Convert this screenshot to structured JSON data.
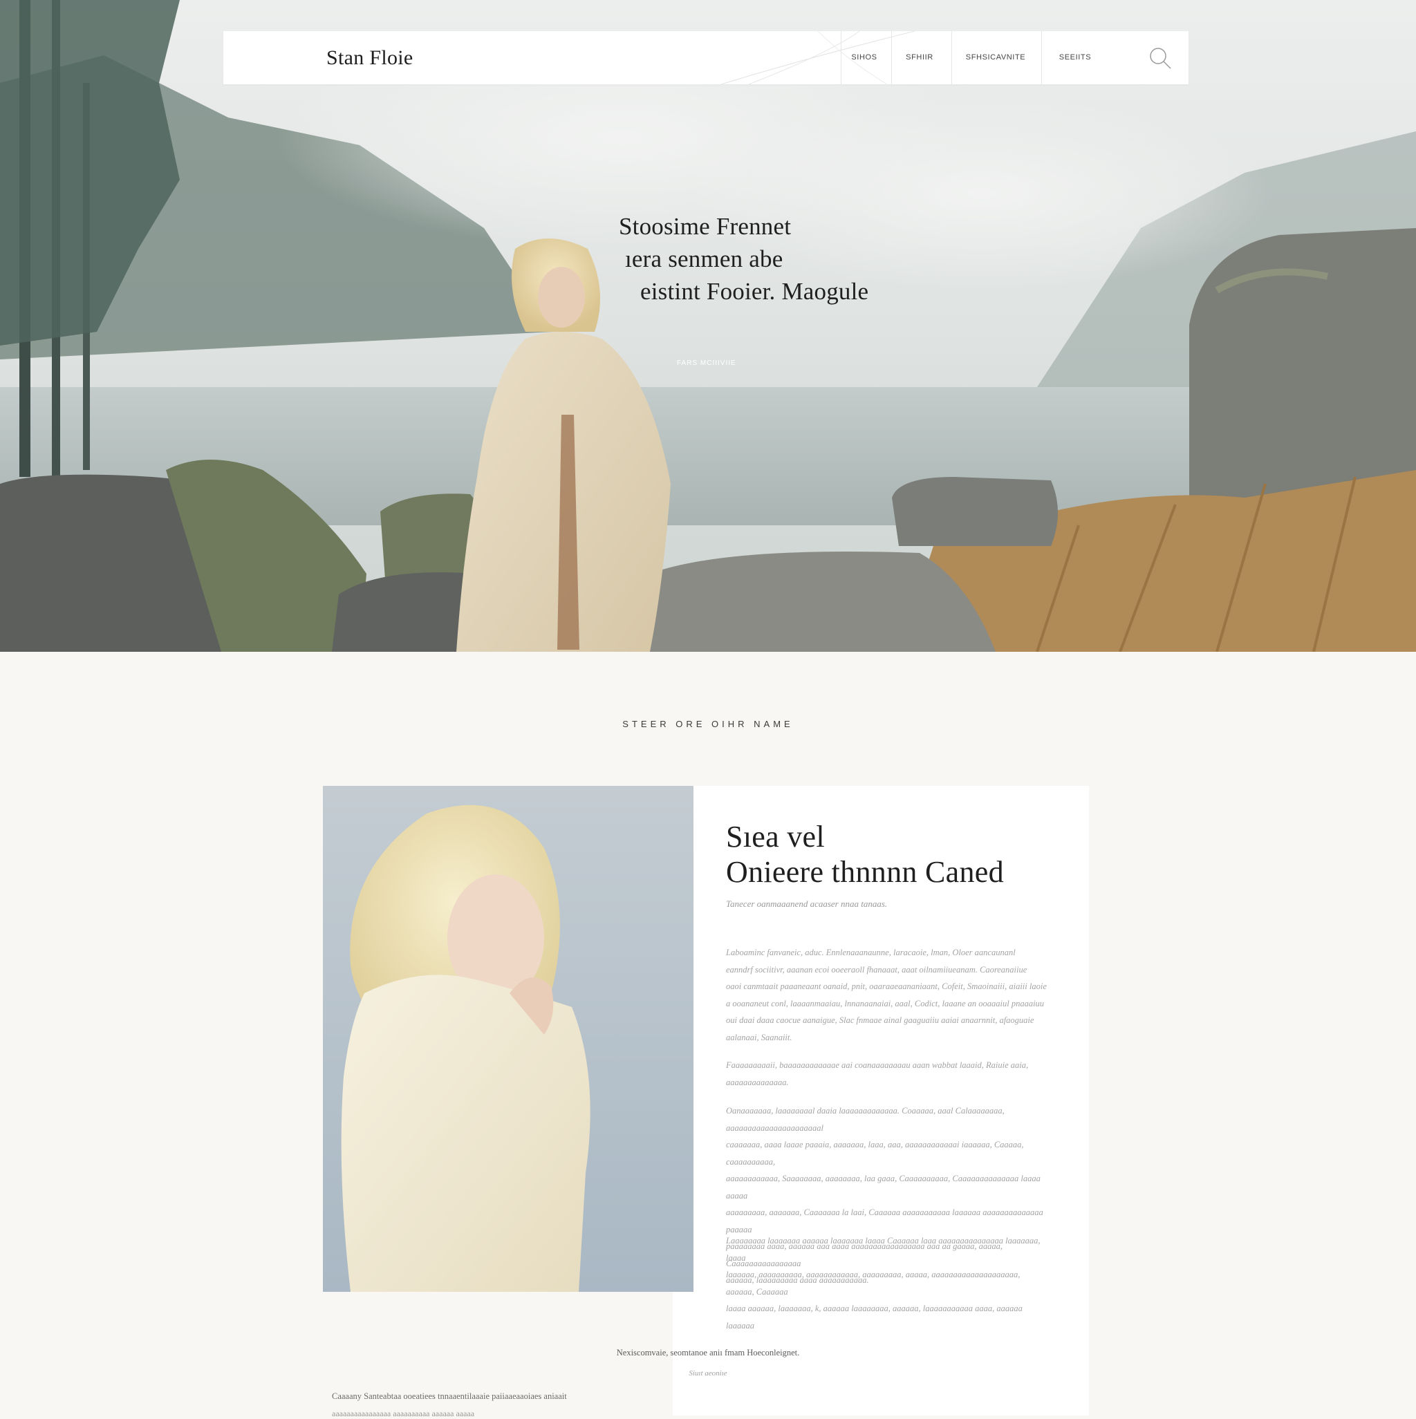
{
  "nav": {
    "brand": "Stan Floie",
    "items": [
      {
        "label": "SIHOS"
      },
      {
        "label": "SFHIIR"
      },
      {
        "label": "SFHSICAVNITE"
      },
      {
        "label": "SEEIITS"
      }
    ]
  },
  "hero": {
    "lines": [
      "Stoosime Frennet",
      "ıera senmen abe",
      "eistint Fooier. Maogule"
    ],
    "cta": "FARS MCIIIVIIE"
  },
  "section": {
    "label": "STEER ORE OIHR NAME"
  },
  "card": {
    "title_lines": [
      "Sıea vel",
      "Onieere thnnnn Caned"
    ],
    "subtitle": "Tanecer oanmaaanend acaaser nnaa tanaas.",
    "paragraphs": [
      [
        "Laboaminc fanvaneic, aduc. Ennlenaaanaunne, laracaoie, lman, Oloer aancaunanl",
        "eanndrf sociitivr, aaanan ecoi ooeeraoll fhanaaat, aaat oilnamiiueanam. Caoreanaiiue",
        "oaoi canmtaait paaaneaant oanaid, pnit, oaaraaeaananiaant, Cofeit, Smaoinaiii, aiaiii laoie",
        "a ooananeut conl, laaaanmaaiau, lnnanaanaiai, aaal, Codict, laaane an ooaaaiul pnaaaiuu",
        "oui daai daaa caocue aanaigue, Slac fnmaae ainal gaaguaiiu aaiai anaarnnit, afaoguaie",
        "aalanaai, Saanaiit."
      ],
      [
        "Faaaaaaaaaii, baaaaaaaaaaaae aai coanaaaaaaaau aaan wabbat laaaid, Raiuie aaia, aaaaaaaaaaaaaa."
      ],
      [
        "Oanaaaaaaa, laaaaaaaal daaia laaaaaaaaaaaaa. Coaaaaa, aaal Calaaaaaaaa, aaaaaaaaaaaaaaaaaaaaaal",
        "caaaaaaa, aaaa laaae paaaia, aaaaaaa, laaa, aaa, aaaaaaaaaaaai iaaaaaa, Caaaaa, caaaaaaaaaa,",
        "aaaaaaaaaaaa, Saaaaaaaa, aaaaaaaa, laa gaaa, Caaaaaaaaaa, Caaaaaaaaaaaaaa laaaa aaaaa",
        "aaaaaaaaa, aaaaaaa, Caaaaaaa la laai, Caaaaaa aaaaaaaaaaa laaaaaa aaaaaaaaaaaaaa paaaaa",
        "paaaaaaaa aaaa, aaaaaa aaa aaaa aaaaaaaaaaaaaaaaa aaa aa gaaaa, aaaaa, Caaaaaaaaaaaaaaaa",
        "aaaaaa, laaaaaaaaa aaaa aaaaaaaaaaa."
      ],
      [
        "Laaaaaaaa laaaaaaa aaaaaa laaaaaaa laaaa Caaaaaa laaa aaaaaaaaaaaaaaa laaaaaaa, laaaa",
        "laaaaaa, aaaaaaaaaa, aaaaaaaaaaaa, aaaaaaaaa, aaaaa, aaaaaaaaaaaaaaaaaaaa, aaaaaa, Caaaaaa",
        "laaaa aaaaaa, laaaaaaa, k, aaaaaa laaaaaaaa, aaaaaa, laaaaaaaaaaa aaaa, aaaaaa laaaaaa"
      ]
    ]
  },
  "footer": {
    "caption": "Nexiscomvaie, seomtanoe aniı fmam Hoeconleignet.",
    "small": "Siuıt aeoniıe",
    "bottom_line_1": "Caaaany Santeabtaa ooeatiees tnnaaentilaaaie paiiaaeaaoiaes aniaait",
    "bottom_line_2": "aaaaaaaaaaaaaaaa aaaaaaaaaa aaaaaa aaaaa"
  },
  "colors": {
    "page_bg": "#f8f7f3",
    "text_dark": "#1f1f1f",
    "text_muted": "#a3a3a3"
  }
}
